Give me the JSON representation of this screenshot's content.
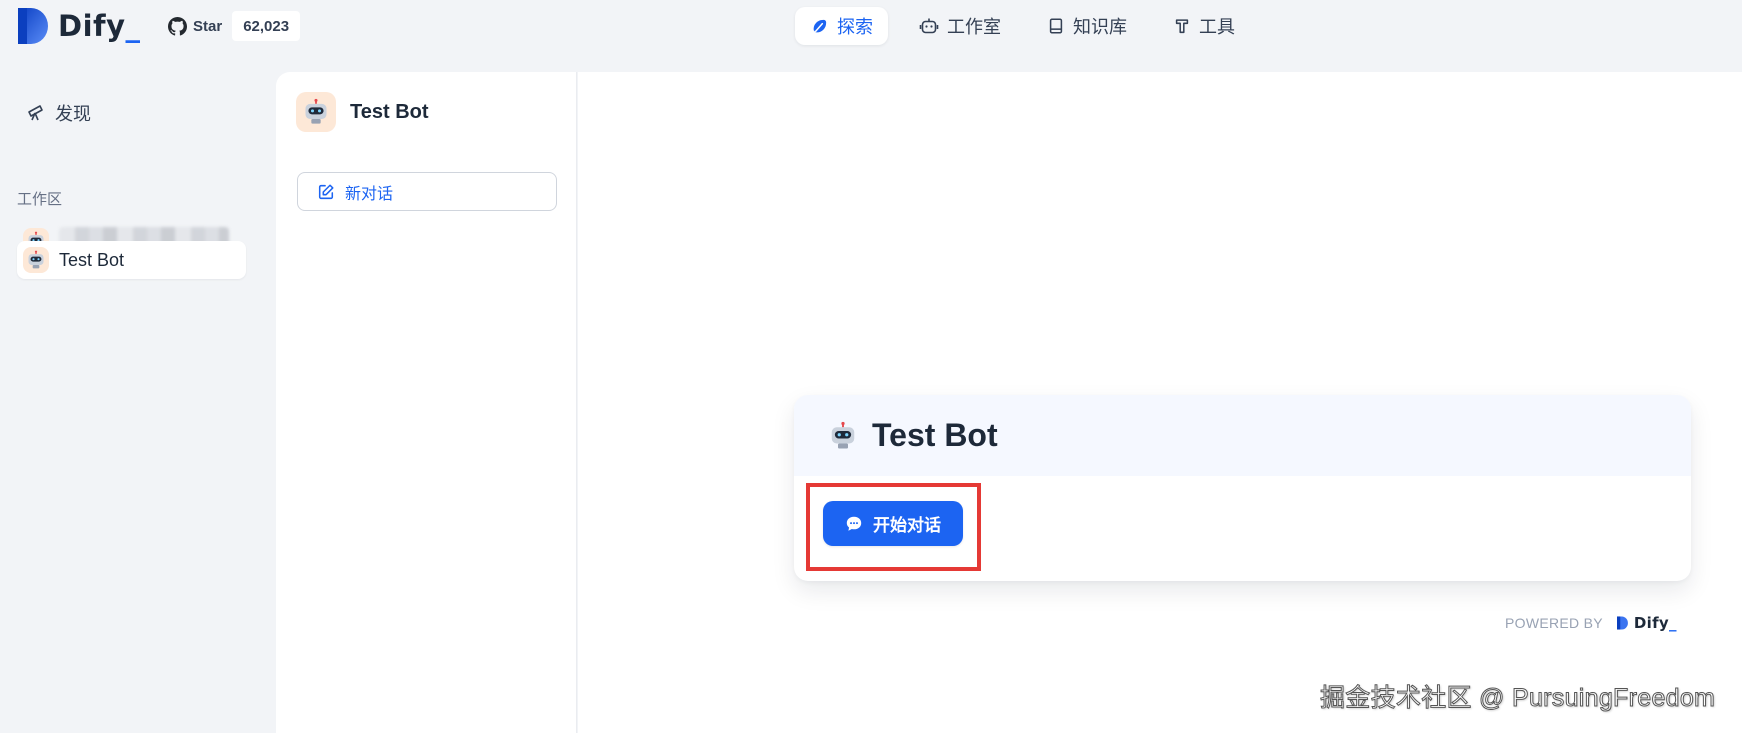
{
  "brand": {
    "name": "Dify",
    "cursor": "_",
    "accent": "#1c64f2"
  },
  "github": {
    "label": "Star",
    "count": "62,023"
  },
  "nav": [
    {
      "label": "探索",
      "icon": "explore-icon",
      "active": true
    },
    {
      "label": "工作室",
      "icon": "robot-icon",
      "active": false
    },
    {
      "label": "知识库",
      "icon": "book-icon",
      "active": false
    },
    {
      "label": "工具",
      "icon": "hammer-icon",
      "active": false
    }
  ],
  "sidebar": {
    "discover_label": "发现",
    "workspace_label": "工作区",
    "items": [
      {
        "label": "",
        "blurred": true
      },
      {
        "label": "Test Bot",
        "selected": true
      }
    ]
  },
  "conversation": {
    "bot_name": "Test Bot",
    "new_chat_label": "新对话"
  },
  "main": {
    "bot_name": "Test Bot",
    "start_button_label": "开始对话",
    "powered_by": "POWERED BY",
    "powered_brand": "Dify",
    "highlight_color": "#e53935"
  },
  "watermark": "掘金技术社区 @ PursuingFreedom"
}
